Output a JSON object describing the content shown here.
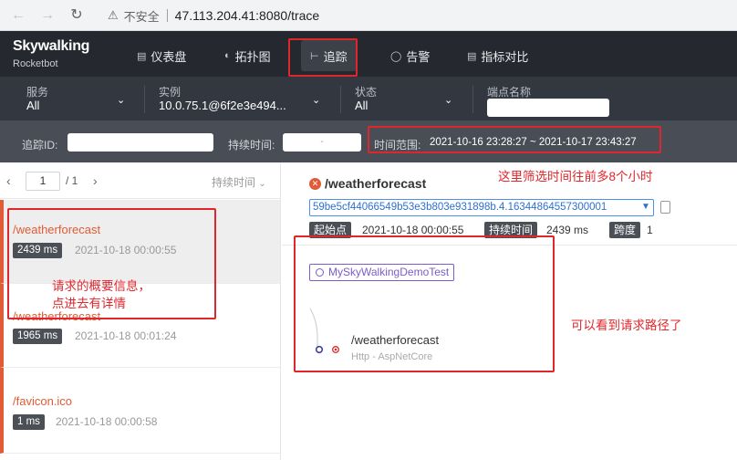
{
  "browser": {
    "insecure_label": "不安全",
    "url": "47.113.204.41:8080/trace"
  },
  "app": {
    "logo_main": "Skywalking",
    "logo_sub": "Rocketbot"
  },
  "nav": {
    "tabs": [
      {
        "label": "仪表盘",
        "icon": "dashboard-icon"
      },
      {
        "label": "拓扑图",
        "icon": "topology-icon"
      },
      {
        "label": "追踪",
        "icon": "trace-icon",
        "active": true
      },
      {
        "label": "告警",
        "icon": "alarm-icon"
      },
      {
        "label": "指标对比",
        "icon": "metrics-compare-icon"
      }
    ]
  },
  "filters": {
    "service_label": "服务",
    "service_value": "All",
    "instance_label": "实例",
    "instance_value": "10.0.75.1@6f2e3e494...",
    "status_label": "状态",
    "status_value": "All",
    "endpoint_label": "端点名称",
    "endpoint_value": ""
  },
  "filters2": {
    "trace_id_label": "追踪ID:",
    "trace_id_value": "",
    "duration_label": "持续时间:",
    "duration_sep": "-",
    "time_range_label": "时间范围:",
    "time_range_value": "2021-10-16 23:28:27 ~ 2021-10-17 23:43:27"
  },
  "pager": {
    "page": "1",
    "total": "/ 1",
    "sort_label": "持续时间"
  },
  "traces": [
    {
      "name": "/weatherforecast",
      "duration": "2439 ms",
      "time": "2021-10-18 00:00:55"
    },
    {
      "name": "/weatherforecast",
      "duration": "1965 ms",
      "time": "2021-10-18 00:01:24"
    },
    {
      "name": "/favicon.ico",
      "duration": "1 ms",
      "time": "2021-10-18 00:00:58"
    }
  ],
  "detail": {
    "title": "/weatherforecast",
    "trace_id": "59be5cf44066549b53e3b803e931898b.4.16344864557300001",
    "start_label": "起始点",
    "start_value": "2021-10-18 00:00:55",
    "duration_label": "持续时间",
    "duration_value": "2439 ms",
    "span_label": "跨度",
    "span_value": "1",
    "service": "MySkyWalkingDemoTest",
    "endpoint": "/weatherforecast",
    "component": "Http - AspNetCore"
  },
  "annotations": {
    "time_note": "这里筛选时间往前多8个小时",
    "summary_note_line1": "请求的概要信息，",
    "summary_note_line2": "点进去有详情",
    "path_note": "可以看到请求路径了"
  },
  "colors": {
    "accent_orange": "#e05b36",
    "annotation_red": "#e0262b",
    "service_purple": "#7b5cc9",
    "header_bg": "#25292f"
  }
}
